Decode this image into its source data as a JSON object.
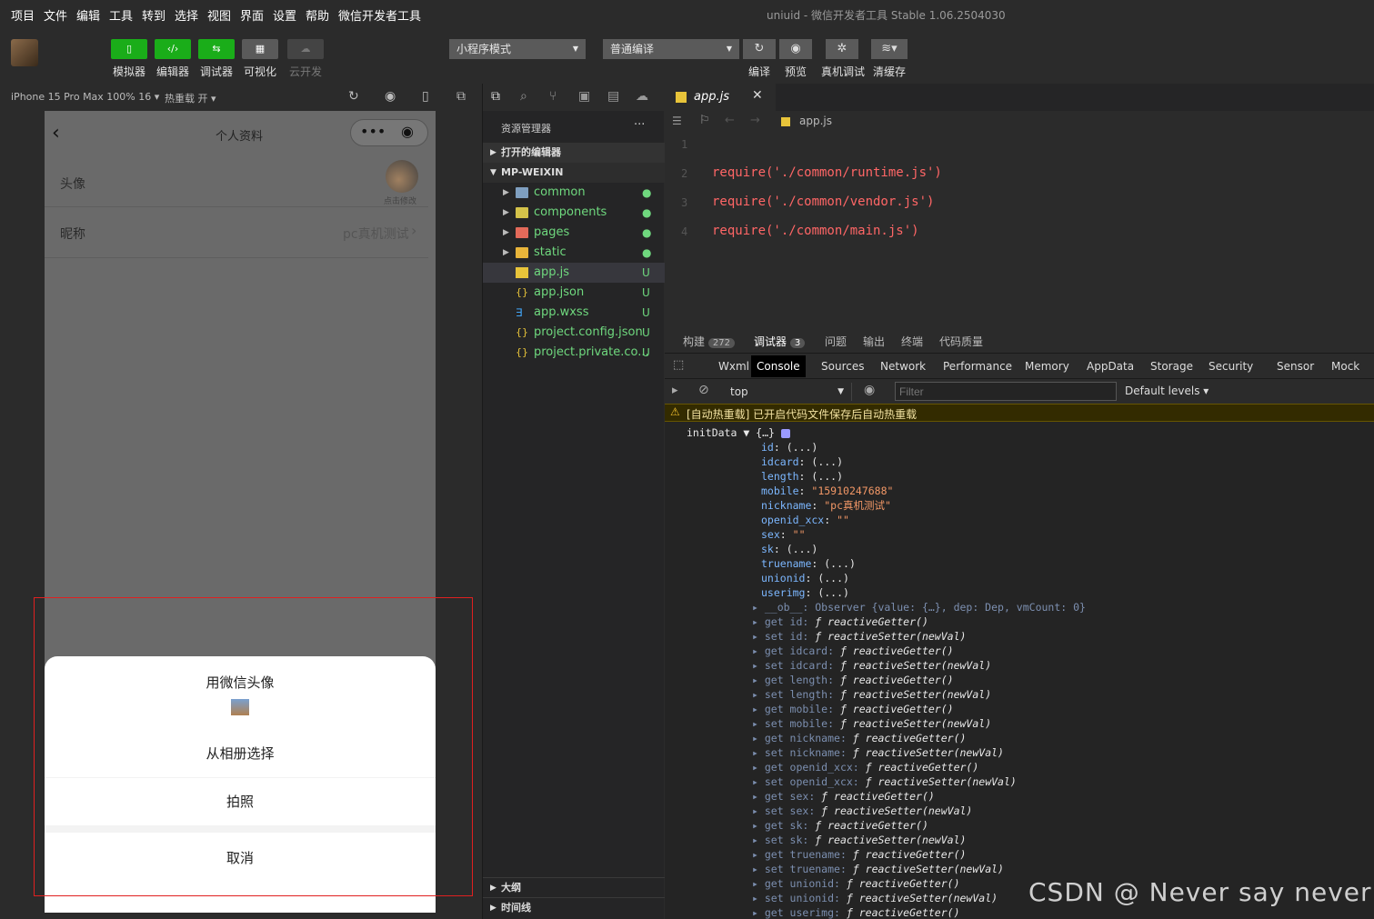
{
  "menu": [
    "项目",
    "文件",
    "编辑",
    "工具",
    "转到",
    "选择",
    "视图",
    "界面",
    "设置",
    "帮助",
    "微信开发者工具"
  ],
  "window_title": "uniuid - 微信开发者工具 Stable 1.06.2504030",
  "toolbar": {
    "simulator": "模拟器",
    "editor": "编辑器",
    "debugger": "调试器",
    "visual": "可视化",
    "cloud": "云开发",
    "mode": "小程序模式",
    "compile_mode": "普通编译",
    "compile": "编译",
    "preview": "预览",
    "real_debug": "真机调试",
    "clear_cache": "清缓存"
  },
  "simbar": {
    "device": "iPhone 15 Pro Max 100% 16",
    "hot_reload": "热重载 开"
  },
  "phone": {
    "page_title": "个人资料",
    "avatar_label": "头像",
    "avatar_hint": "点击修改",
    "nickname_label": "昵称",
    "nickname_value": "pc真机测试",
    "sheet": {
      "use_wechat_avatar": "用微信头像",
      "choose_album": "从相册选择",
      "take_photo": "拍照",
      "cancel": "取消"
    }
  },
  "explorer": {
    "title": "资源管理器",
    "open_editors": "打开的编辑器",
    "root": "MP-WEIXIN",
    "items": [
      {
        "name": "common",
        "status": "●",
        "type": "folder"
      },
      {
        "name": "components",
        "status": "●",
        "type": "folder"
      },
      {
        "name": "pages",
        "status": "●",
        "type": "folder"
      },
      {
        "name": "static",
        "status": "●",
        "type": "folder"
      },
      {
        "name": "app.js",
        "status": "U",
        "type": "js"
      },
      {
        "name": "app.json",
        "status": "U",
        "type": "json"
      },
      {
        "name": "app.wxss",
        "status": "U",
        "type": "css"
      },
      {
        "name": "project.config.json",
        "status": "U",
        "type": "json"
      },
      {
        "name": "project.private.co...",
        "status": "U",
        "type": "json"
      }
    ],
    "outline": "大纲",
    "timeline": "时间线"
  },
  "editor": {
    "tab": "app.js",
    "breadcrumb": "app.js",
    "lines": [
      "1",
      "2",
      "3",
      "4"
    ],
    "code": [
      "",
      "require('./common/runtime.js')",
      "require('./common/vendor.js')",
      "require('./common/main.js')"
    ]
  },
  "devtools": {
    "tabs": [
      {
        "label": "构建",
        "badge": "272"
      },
      {
        "label": "调试器",
        "badge": "3"
      },
      {
        "label": "问题"
      },
      {
        "label": "输出"
      },
      {
        "label": "终端"
      },
      {
        "label": "代码质量"
      }
    ],
    "panels": [
      "Wxml",
      "Console",
      "Sources",
      "Network",
      "Performance",
      "Memory",
      "AppData",
      "Storage",
      "Security",
      "Sensor",
      "Mock"
    ],
    "context": "top",
    "filter_placeholder": "Filter",
    "levels": "Default levels",
    "warning": "[自动热重载] 已开启代码文件保存后自动热重载",
    "object_name": "initData",
    "object_preview": "{…}",
    "props": [
      {
        "k": "id",
        "v": "(...)"
      },
      {
        "k": "idcard",
        "v": "(...)"
      },
      {
        "k": "length",
        "v": "(...)"
      },
      {
        "k": "mobile",
        "v": "\"15910247688\""
      },
      {
        "k": "nickname",
        "v": "\"pc真机测试\""
      },
      {
        "k": "openid_xcx",
        "v": "\"\""
      },
      {
        "k": "sex",
        "v": "\"\""
      },
      {
        "k": "sk",
        "v": "(...)"
      },
      {
        "k": "truename",
        "v": "(...)"
      },
      {
        "k": "unionid",
        "v": "(...)"
      },
      {
        "k": "userimg",
        "v": "(...)"
      }
    ],
    "observer": "__ob__: Observer {value: {…}, dep: Dep, vmCount: 0}",
    "accessors": [
      "get id: ƒ reactiveGetter()",
      "set id: ƒ reactiveSetter(newVal)",
      "get idcard: ƒ reactiveGetter()",
      "set idcard: ƒ reactiveSetter(newVal)",
      "get length: ƒ reactiveGetter()",
      "set length: ƒ reactiveSetter(newVal)",
      "get mobile: ƒ reactiveGetter()",
      "set mobile: ƒ reactiveSetter(newVal)",
      "get nickname: ƒ reactiveGetter()",
      "set nickname: ƒ reactiveSetter(newVal)",
      "get openid_xcx: ƒ reactiveGetter()",
      "set openid_xcx: ƒ reactiveSetter(newVal)",
      "get sex: ƒ reactiveGetter()",
      "set sex: ƒ reactiveSetter(newVal)",
      "get sk: ƒ reactiveGetter()",
      "set sk: ƒ reactiveSetter(newVal)",
      "get truename: ƒ reactiveGetter()",
      "set truename: ƒ reactiveSetter(newVal)",
      "get unionid: ƒ reactiveGetter()",
      "set unionid: ƒ reactiveSetter(newVal)",
      "get userimg: ƒ reactiveGetter()"
    ]
  },
  "watermark": "CSDN @     Never say never",
  "colors": {
    "accent": "#1aad19",
    "highlight": "#e02020",
    "tree_green": "#6fd87e"
  }
}
